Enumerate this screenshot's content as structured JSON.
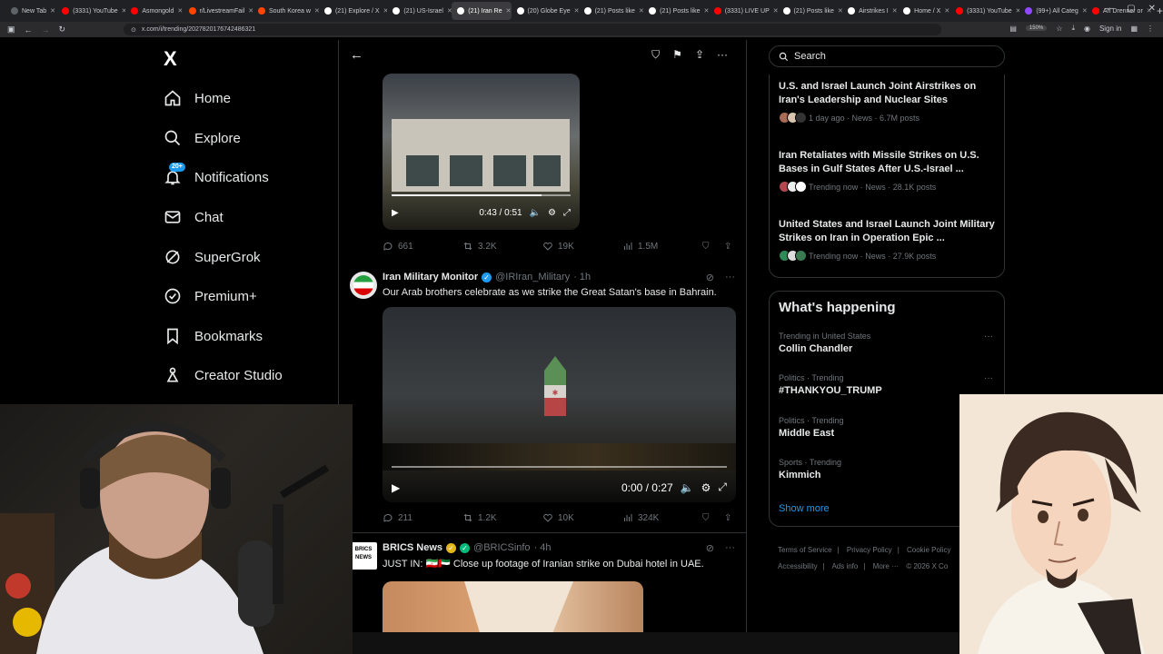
{
  "browser": {
    "tabs": [
      {
        "label": "New Tab",
        "color": "#5f6368"
      },
      {
        "label": "(3331) YouTube",
        "color": "#ff0000"
      },
      {
        "label": "Asmongold",
        "color": "#ff0000"
      },
      {
        "label": "r/LivestreamFail",
        "color": "#ff4500"
      },
      {
        "label": "South Korea w",
        "color": "#ff4500"
      },
      {
        "label": "(21) Explore / X",
        "color": "#ffffff"
      },
      {
        "label": "(21) US-Israel",
        "color": "#ffffff"
      },
      {
        "label": "(21) Iran Re",
        "color": "#ffffff",
        "active": true
      },
      {
        "label": "(20) Globe Eye",
        "color": "#ffffff"
      },
      {
        "label": "(21) Posts like",
        "color": "#ffffff"
      },
      {
        "label": "(21) Posts like",
        "color": "#ffffff"
      },
      {
        "label": "(3331) LIVE UP",
        "color": "#ff0000"
      },
      {
        "label": "(21) Posts like",
        "color": "#ffffff"
      },
      {
        "label": "Airstrikes I",
        "color": "#ffffff"
      },
      {
        "label": "Home / X",
        "color": "#ffffff"
      },
      {
        "label": "(3331) YouTube",
        "color": "#ff0000"
      },
      {
        "label": "(99+) All Categ",
        "color": "#9146ff"
      },
      {
        "label": "Ari Drenner or",
        "color": "#ff0000"
      }
    ],
    "url": "x.com/i/trending/2027820176742486321",
    "zoom": "150%",
    "signin": "Sign in"
  },
  "nav": {
    "logo": "X",
    "items": [
      {
        "label": "Home",
        "icon": "home-icon"
      },
      {
        "label": "Explore",
        "icon": "search-icon"
      },
      {
        "label": "Notifications",
        "icon": "bell-icon",
        "badge": "20+"
      },
      {
        "label": "Chat",
        "icon": "mail-icon"
      },
      {
        "label": "SuperGrok",
        "icon": "grok-icon"
      },
      {
        "label": "Premium+",
        "icon": "verified-icon"
      },
      {
        "label": "Bookmarks",
        "icon": "bookmark-icon"
      },
      {
        "label": "Creator Studio",
        "icon": "creator-icon"
      }
    ]
  },
  "feed": {
    "video1": {
      "time": "0:43 / 0:51",
      "progress": 0.84
    },
    "stats1": {
      "replies": "661",
      "reposts": "3.2K",
      "likes": "19K",
      "views": "1.5M"
    },
    "post2": {
      "name": "Iran Military Monitor",
      "handle": "@IRIran_Military",
      "age": "· 1h",
      "text": "Our Arab brothers celebrate as we strike the Great Satan's base in Bahrain.",
      "video_time": "0:00 / 0:27",
      "progress": 0.0
    },
    "stats2": {
      "replies": "211",
      "reposts": "1.2K",
      "likes": "10K",
      "views": "324K"
    },
    "post3": {
      "name": "BRICS News",
      "handle": "@BRICSinfo",
      "age": "· 4h",
      "text": "JUST IN: 🇮🇷🇦🇪 Close up footage of Iranian strike on Dubai hotel in UAE.",
      "avatar_text": "BRICS NEWS"
    }
  },
  "right": {
    "search_placeholder": "Search",
    "news": [
      {
        "title": "U.S. and Israel Launch Joint Airstrikes on Iran's Leadership and Nuclear Sites",
        "meta": "1 day ago · News · 6.7M posts"
      },
      {
        "title": "Iran Retaliates with Missile Strikes on U.S. Bases in Gulf States After U.S.-Israel ...",
        "meta": "Trending now · News · 28.1K posts"
      },
      {
        "title": "United States and Israel Launch Joint Military Strikes on Iran in Operation Epic ...",
        "meta": "Trending now · News · 27.9K posts"
      }
    ],
    "happening": {
      "title": "What's happening",
      "trends": [
        {
          "context": "Trending in United States",
          "topic": "Collin Chandler"
        },
        {
          "context": "Politics · Trending",
          "topic": "#THANKYOU_TRUMP"
        },
        {
          "context": "Politics · Trending",
          "topic": "Middle East"
        },
        {
          "context": "Sports · Trending",
          "topic": "Kimmich"
        }
      ],
      "show_more": "Show more"
    },
    "footer": [
      "Terms of Service",
      "|",
      "Privacy Policy",
      "|",
      "Cookie Policy",
      "Accessibility",
      "|",
      "Ads info",
      "|",
      "More ···",
      "© 2026 X Co"
    ]
  },
  "colors": {
    "accent": "#1d9bf0",
    "verified_blue": "#1d9bf0",
    "verified_gold": "#e2b719"
  }
}
